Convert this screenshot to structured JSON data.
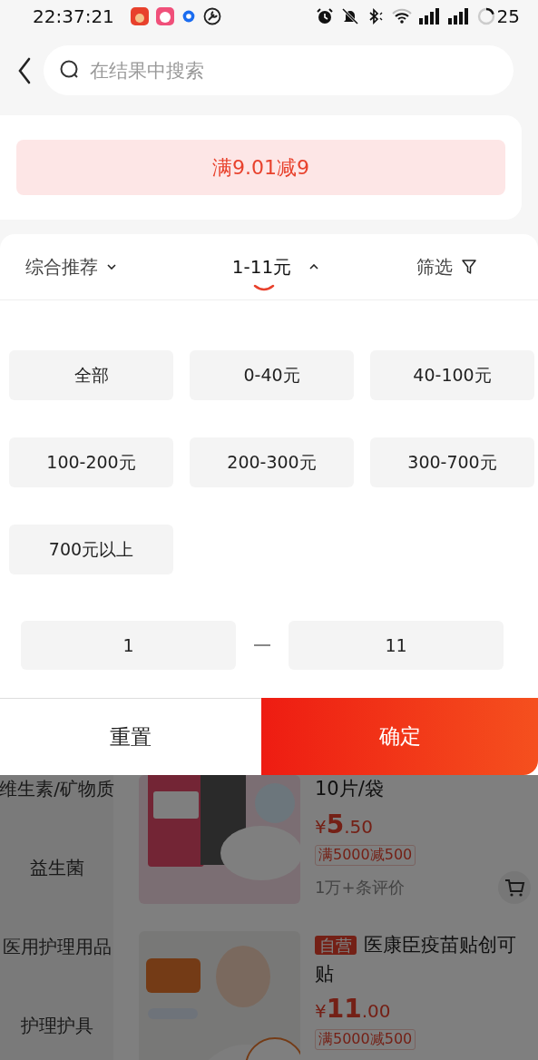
{
  "status_bar": {
    "time": "22:37:21",
    "battery": "25"
  },
  "search": {
    "placeholder": "在结果中搜索"
  },
  "promo": {
    "label": "满9.01减9"
  },
  "sort_tabs": [
    {
      "label": "综合推荐",
      "kind": "sort",
      "selected": false,
      "expanded": false
    },
    {
      "label": "1-11元",
      "kind": "sort",
      "selected": true,
      "expanded": true
    },
    {
      "label": "筛选",
      "kind": "filter",
      "selected": false
    }
  ],
  "price_options": [
    {
      "label": "全部",
      "selected": false
    },
    {
      "label": "0-40元",
      "selected": false
    },
    {
      "label": "40-100元",
      "selected": false
    },
    {
      "label": "100-200元",
      "selected": false
    },
    {
      "label": "200-300元",
      "selected": false
    },
    {
      "label": "300-700元",
      "selected": false
    },
    {
      "label": "700元以上",
      "selected": false
    }
  ],
  "price_range": {
    "min": "1",
    "max": "11"
  },
  "buttons": {
    "reset": "重置",
    "confirm": "确定"
  },
  "categories": [
    "维生素/矿物质",
    "益生菌",
    "医用护理用品",
    "护理护具"
  ],
  "products": [
    {
      "title": "10片/袋",
      "currency": "¥",
      "price_main": "5",
      "price_cents": ".50",
      "promo": "满5000减500",
      "reviews": "1万+条评价",
      "cart": true
    },
    {
      "badge": "自营",
      "title": "医康臣疫苗贴创可贴",
      "currency": "¥",
      "price_main": "11",
      "price_cents": ".00",
      "promo": "满5000减500"
    }
  ]
}
